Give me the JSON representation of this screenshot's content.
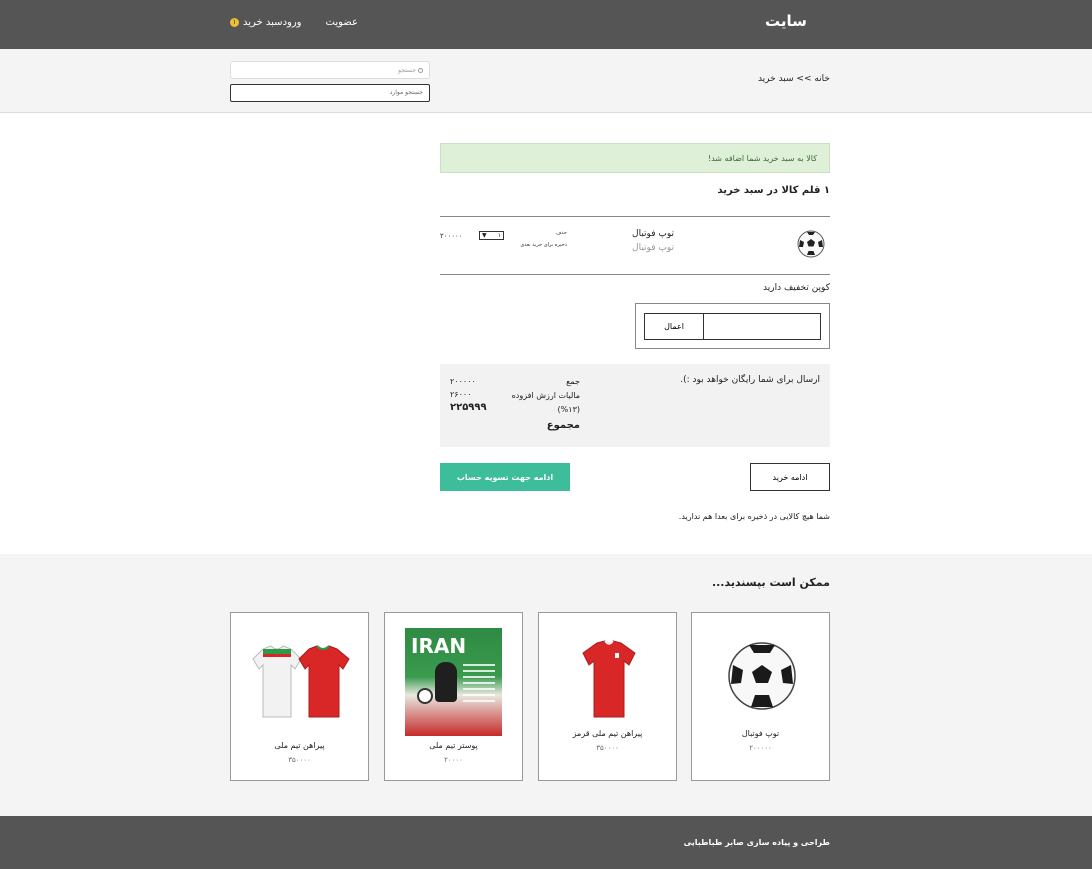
{
  "header": {
    "brand": "سایت",
    "nav": {
      "membership": "عضویت",
      "login": "ورود",
      "cart": "سبد خرید",
      "cart_count": "۱"
    }
  },
  "breadcrumb": "خانه >> سبد خرید",
  "search": {
    "label": "جستجو",
    "placeholder": "جستجو موارد"
  },
  "alert": "کالا به سبد خرید شما اضافه شد!",
  "cart": {
    "heading": "۱ قلم کالا در سبد خرید",
    "item": {
      "name": "توپ فوتبال",
      "subtitle": "توپ فوتبال",
      "remove": "حذف",
      "save_later": "ذخیره برای خرید بعدی",
      "quantity": "۱",
      "price": "۲۰۰۰۰۰"
    }
  },
  "coupon": {
    "label": "کوپن تخفیف دارید",
    "apply": "اعمال"
  },
  "summary": {
    "free_shipping": "ارسال برای شما رایگان خواهد بود :).",
    "subtotal_label": "جمع",
    "tax_label": "مالیات ارزش افزوده (۱۳%)",
    "total_label": "مجموع",
    "subtotal": "۲۰۰۰۰۰",
    "tax": "۲۶۰۰۰",
    "total": "۲۲۵۹۹۹"
  },
  "actions": {
    "continue": "ادامه خرید",
    "checkout": "ادامه جهت تسویه حساب"
  },
  "saved_notice": "شما هیچ کالایی در ذخیره برای بعدا هم ندارید.",
  "recommendations": {
    "title": "ممکن است بپسندید...",
    "items": [
      {
        "name": "توپ فوتبال",
        "price": "۲۰۰۰۰۰"
      },
      {
        "name": "پیراهن تیم ملی قرمز",
        "price": "۳۵۰۰۰۰"
      },
      {
        "name": "پوستر تیم ملی",
        "price": "۲۰۰۰۰"
      },
      {
        "name": "پیراهن تیم ملی",
        "price": "۳۵۰۰۰۰"
      }
    ],
    "poster_text": "IRAN"
  },
  "footer": "طراحی و پیاده سازی صابر طباطبایی",
  "colors": {
    "header": "#555555",
    "accent": "#3dbd9a",
    "alert_bg": "#dff0d8"
  }
}
